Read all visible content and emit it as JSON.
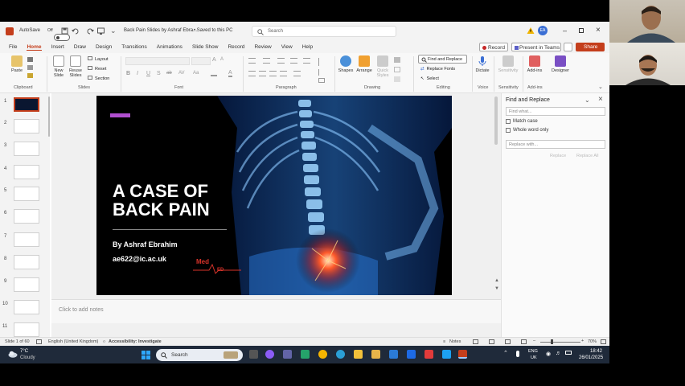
{
  "title_bar": {
    "autosave_label": "AutoSave",
    "autosave_state": "Off",
    "doc_title": "Back Pain Slides by Ashraf Ebra...",
    "save_status": "•  Saved to this PC",
    "search_placeholder": "Search",
    "user_initials": "EA"
  },
  "menu": {
    "items": [
      "File",
      "Home",
      "Insert",
      "Draw",
      "Design",
      "Transitions",
      "Animations",
      "Slide Show",
      "Record",
      "Review",
      "View",
      "Help"
    ],
    "record_label": "Record",
    "present_label": "Present in Teams",
    "share_label": "Share"
  },
  "ribbon": {
    "paste": "Paste",
    "new_slide": "New Slide",
    "reuse_slides": "Reuse Slides",
    "layout": "Layout",
    "reset": "Reset",
    "section": "Section",
    "shapes": "Shapes",
    "arrange": "Arrange",
    "quick_styles": "Quick Styles",
    "find_replace": "Find and Replace",
    "replace_fonts": "Replace Fonts",
    "select": "Select",
    "dictate": "Dictate",
    "sensitivity": "Sensitivity",
    "addins": "Add-ins",
    "designer": "Designer",
    "groups": {
      "clipboard": "Clipboard",
      "slides": "Slides",
      "font": "Font",
      "paragraph": "Paragraph",
      "drawing": "Drawing",
      "editing": "Editing",
      "voice": "Voice",
      "sensitivity": "Sensitivity",
      "addins": "Add-ins"
    }
  },
  "thumbnails": {
    "numbers": [
      "1",
      "2",
      "3",
      "4",
      "5",
      "6",
      "7",
      "8",
      "9",
      "10",
      "11"
    ]
  },
  "slide": {
    "title_line1": "A CASE OF",
    "title_line2": "BACK PAIN",
    "author": "By Ashraf Ebrahim",
    "email": "ae622@ic.ac.uk",
    "logo_text_top": "Med",
    "logo_text_bottom": "ED",
    "accent_color": "#b04fcf"
  },
  "notes_placeholder": "Click to add notes",
  "find_pane": {
    "title": "Find and Replace",
    "find_placeholder": "Find what...",
    "match_case": "Match case",
    "whole_word": "Whole word only",
    "replace_placeholder": "Replace with...",
    "replace_btn": "Replace",
    "replace_all_btn": "Replace All"
  },
  "status_bar": {
    "slide_info": "Slide 1 of 60",
    "language": "English (United Kingdom)",
    "accessibility": "Accessibility: Investigate",
    "notes": "Notes",
    "zoom": "70%"
  },
  "taskbar": {
    "temp": "7°C",
    "weather": "Cloudy",
    "search": "Search",
    "lang": "ENG",
    "region": "UK",
    "time": "18:42",
    "date": "26/01/2025"
  },
  "colors": {
    "accent": "#c43e1c",
    "taskbar": "#1f2a3a"
  }
}
